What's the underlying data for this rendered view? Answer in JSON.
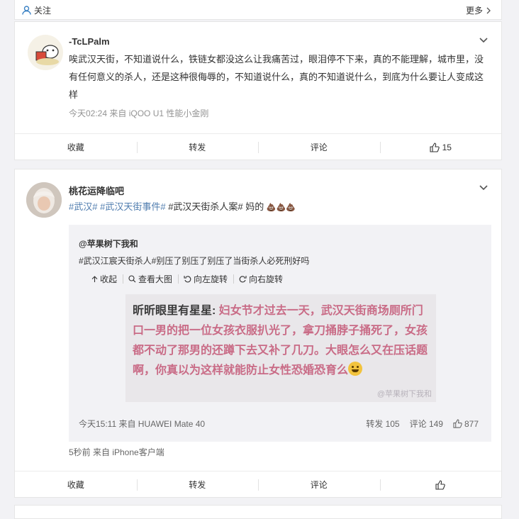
{
  "topbar": {
    "follow_label": "关注",
    "more_label": "更多"
  },
  "post1": {
    "username": "-TcLPalm",
    "text": "唉武汉天街，不知道说什么，铁链女都没这么让我痛苦过，眼泪停不下来，真的不能理解，城市里，没有任何意义的杀人，还是这种很侮辱的，不知道说什么，真的不知道说什么，到底为什么要让人变成这样",
    "meta": "今天02:24  来自 iQOO U1 性能小金刚",
    "actions": {
      "collect": "收藏",
      "repost": "转发",
      "comment": "评论",
      "like": "15"
    }
  },
  "post2": {
    "username": "桃花运降临吧",
    "tags": [
      "#武汉#",
      "#武汉天街事件#"
    ],
    "text_rest": "#武汉天街杀人案# 妈的",
    "emoji_text": "💩💩💩",
    "repost": {
      "username": "@苹果树下我和",
      "text": "#武汉江宸天街杀人#别压了别压了别压了当街杀人必死刑好吗",
      "tools": [
        "收起",
        "查看大图",
        "向左旋转",
        "向右旋转"
      ],
      "image": {
        "author": "昕昕眼里有星星:",
        "body": " 妇女节才过去一天，武汉天街商场厕所门口一男的把一位女孩衣服扒光了，拿刀捅脖子捅死了，女孩都不动了那男的还蹲下去又补了几刀。大眼怎么又在压话题啊，你真以为这样就能防止女性恐婚恐育么",
        "watermark": "@苹果树下我和"
      },
      "meta": "今天15:11 来自 HUAWEI Mate 40",
      "repost_label": "转发 105",
      "comment_label": "评论 149",
      "like_count": "877"
    },
    "meta": "5秒前  来自 iPhone客户端",
    "actions": {
      "collect": "收藏",
      "repost": "转发",
      "comment": "评论",
      "like": ""
    }
  }
}
